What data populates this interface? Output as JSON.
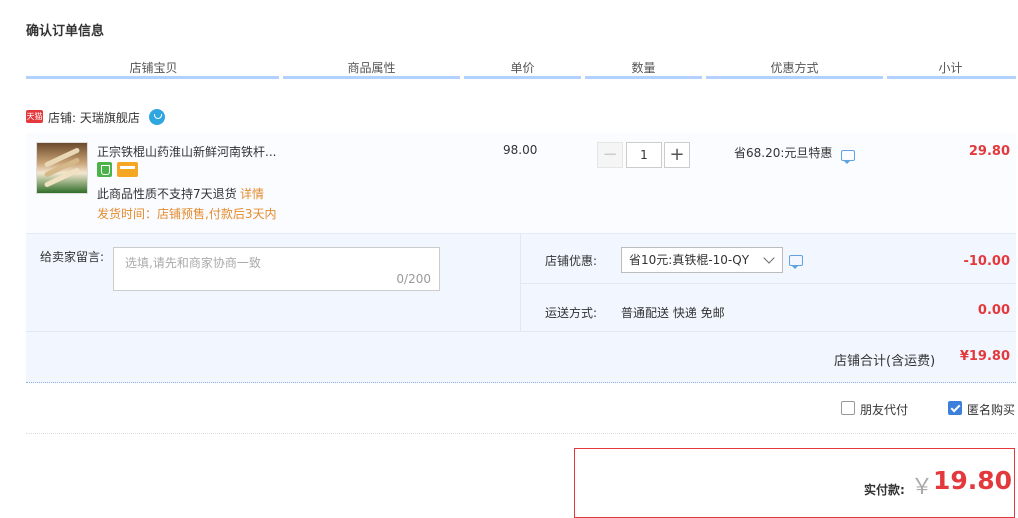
{
  "page_title": "确认订单信息",
  "columns": [
    "店铺宝贝",
    "商品属性",
    "单价",
    "数量",
    "优惠方式",
    "小计"
  ],
  "shop": {
    "badge": "天猫",
    "label": "店铺: 天瑞旗舰店"
  },
  "item": {
    "title": "正宗铁棍山药淮山新鲜河南铁杆...",
    "no_return": "此商品性质不支持7天退货",
    "detail_link": "详情",
    "ship_time": "发货时间：店铺预售,付款后3天内",
    "price": "98.00",
    "qty_minus": "−",
    "qty_value": "1",
    "qty_plus": "+",
    "promo": "省68.20:元旦特惠",
    "subtotal": "29.80"
  },
  "seller_message": {
    "label": "给卖家留言:",
    "placeholder": "选填,请先和商家协商一致",
    "count": "0/200"
  },
  "shop_discount": {
    "label": "店铺优惠:",
    "selected": "省10元:真铁棍-10-QY",
    "amount": "-10.00"
  },
  "shipping": {
    "label": "运送方式:",
    "value": "普通配送 快递 免邮",
    "amount": "0.00"
  },
  "shop_total": {
    "label": "店铺合计(含运费)",
    "value": "¥19.80"
  },
  "options": {
    "friend_pay": {
      "label": "朋友代付",
      "checked": false
    },
    "anonymous": {
      "label": "匿名购买",
      "checked": true
    }
  },
  "payment": {
    "label": "实付款:",
    "currency": "￥",
    "amount": "19.80"
  },
  "colors": {
    "accent_red": "#e4393c",
    "header_bar": "#b2d1ff",
    "checkbox_blue": "#3e7fdb",
    "note_orange": "#e38b2e"
  }
}
